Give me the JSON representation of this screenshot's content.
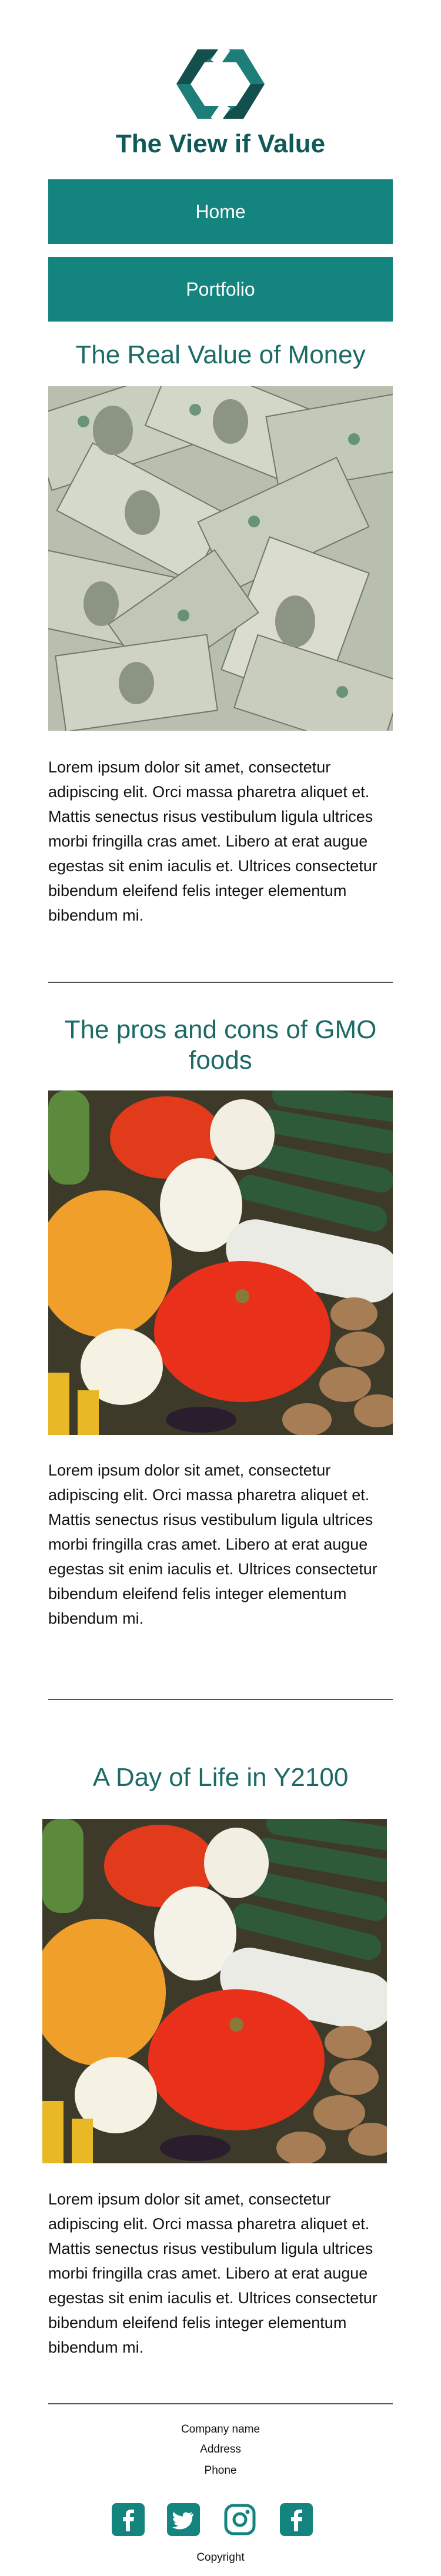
{
  "site": {
    "title": "The View if Value"
  },
  "nav": {
    "items": [
      {
        "label": "Home"
      },
      {
        "label": "Portfolio"
      }
    ]
  },
  "sections": [
    {
      "title": "The Real Value of Money",
      "image": "money-photo",
      "text": "Lorem ipsum dolor sit amet, consectetur adipiscing elit. Orci massa pharetra aliquet et. Mattis senectus risus vestibulum ligula ultrices morbi fringilla cras amet. Libero at erat augue egestas sit enim iaculis et. Ultrices consectetur bibendum eleifend felis integer elementum bibendum mi."
    },
    {
      "title": "The pros and cons of GMO foods",
      "image": "vegetables-photo",
      "text": "Lorem ipsum dolor sit amet, consectetur adipiscing elit. Orci massa pharetra aliquet et. Mattis senectus risus vestibulum ligula ultrices morbi fringilla cras amet. Libero at erat augue egestas sit enim iaculis et. Ultrices consectetur bibendum eleifend felis integer elementum bibendum mi."
    },
    {
      "title": "A Day of Life in Y2100",
      "image": "vegetables-photo",
      "text": "Lorem ipsum dolor sit amet, consectetur adipiscing elit. Orci massa pharetra aliquet et. Mattis senectus risus vestibulum ligula ultrices morbi fringilla cras amet. Libero at erat augue egestas sit enim iaculis et. Ultrices consectetur bibendum eleifend felis integer elementum bibendum mi."
    }
  ],
  "footer": {
    "company": "Company name",
    "address": "Address",
    "phone": "Phone",
    "copyright": "Copyright",
    "social": [
      "facebook-icon",
      "twitter-icon",
      "instagram-icon",
      "facebook-icon"
    ]
  },
  "colors": {
    "accent": "#14847f",
    "heading": "#1b6a66",
    "title": "#0f5a58"
  }
}
